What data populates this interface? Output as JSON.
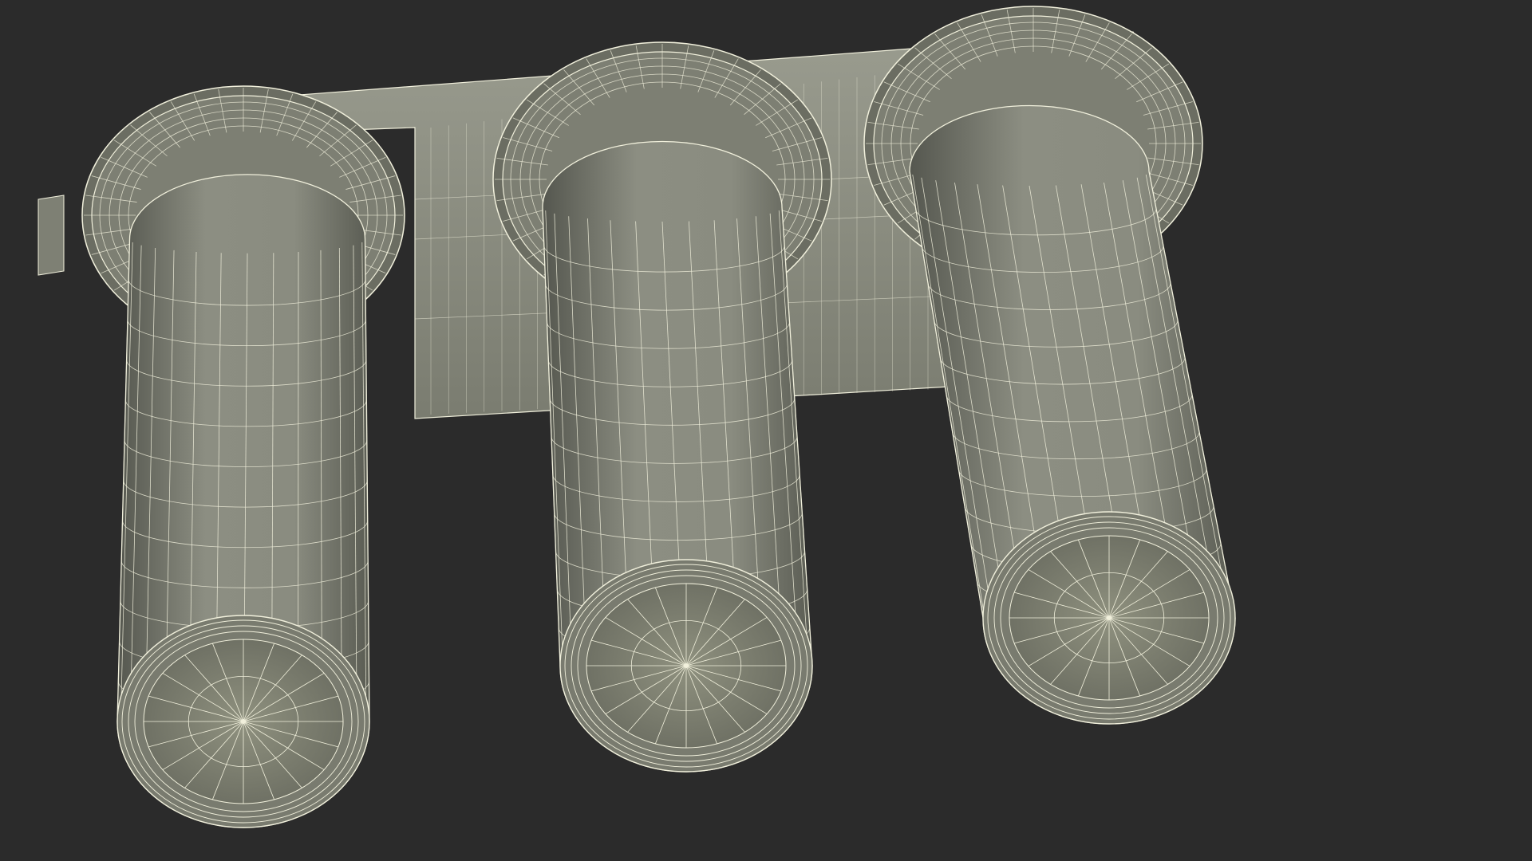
{
  "scene": {
    "subject": "three-filter-housing-wireframe",
    "filter_count": 3
  },
  "colors": {
    "background": "#2b2b2b",
    "surface": "#85877b",
    "surface_dark": "#5c5e55",
    "surface_light": "#a3a596",
    "wire": "#f1f0dc",
    "bracket": "#8a8c80"
  }
}
